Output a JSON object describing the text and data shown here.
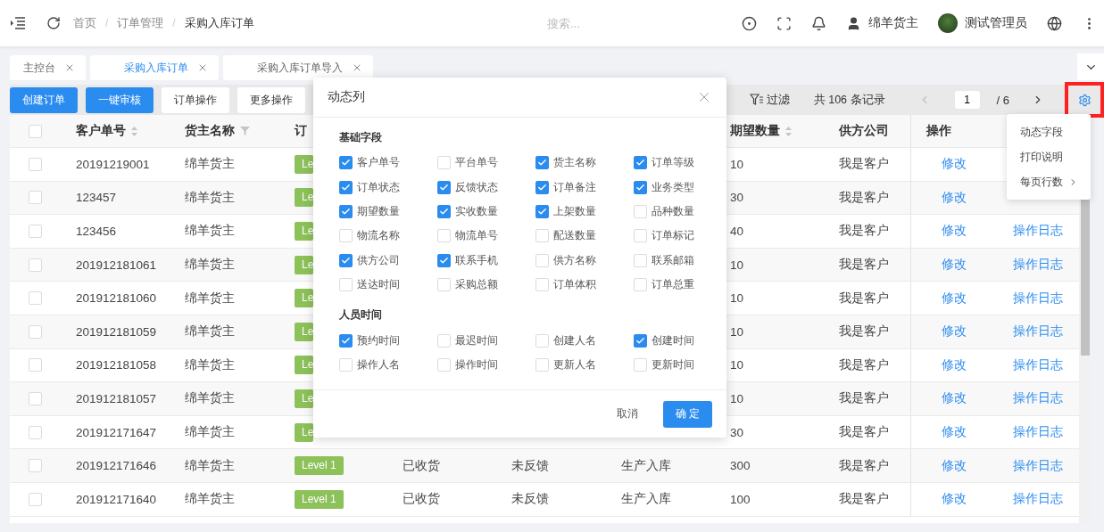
{
  "header": {
    "breadcrumb": [
      {
        "label": "首页",
        "current": false
      },
      {
        "label": "订单管理",
        "current": false
      },
      {
        "label": "采购入库订单",
        "current": true
      }
    ],
    "breadcrumb_separator": "/",
    "search": {
      "placeholder": "搜索..."
    },
    "user": "绵羊货主",
    "admin": "测试管理员"
  },
  "tabs": [
    {
      "label": "主控台",
      "selected": false
    },
    {
      "label": "采购入库订单",
      "selected": true
    },
    {
      "label": "采购入库订单导入",
      "selected": false
    }
  ],
  "toolbar": {
    "buttons": [
      {
        "label": "创建订单",
        "kind": "primary"
      },
      {
        "label": "一键审核",
        "kind": "primary"
      },
      {
        "label": "订单操作",
        "kind": "default"
      },
      {
        "label": "更多操作",
        "kind": "default"
      }
    ],
    "filter": "过滤",
    "total": "共 106 条记录",
    "page": "1",
    "pages": "/ 6",
    "settings_highlighted": true
  },
  "table": {
    "select_all_checked": false,
    "columns": [
      {
        "label": "客户单号",
        "kind": "sortable"
      },
      {
        "label": "货主名称",
        "kind": "filterable"
      },
      {
        "label": "订",
        "kind": "plain"
      },
      {
        "kind": "hidden"
      },
      {
        "kind": "hidden"
      },
      {
        "kind": "hidden"
      },
      {
        "label": "期望数量",
        "kind": "sortable"
      },
      {
        "label": "供方公司",
        "kind": "plain"
      },
      {
        "label": "操作",
        "kind": "plain"
      }
    ],
    "rows": [
      {
        "checked": false,
        "id": "20191219001",
        "owner": "绵羊货主",
        "level": "Le",
        "qty": "10",
        "supplier": "我是客户",
        "edit": "修改"
      },
      {
        "checked": false,
        "id": "123457",
        "owner": "绵羊货主",
        "level": "Le",
        "qty": "30",
        "supplier": "我是客户",
        "edit": "修改"
      },
      {
        "checked": false,
        "id": "123456",
        "owner": "绵羊货主",
        "level": "Le",
        "qty": "40",
        "supplier": "我是客户",
        "edit": "修改",
        "log": "操作日志"
      },
      {
        "checked": false,
        "id": "201912181061",
        "owner": "绵羊货主",
        "level": "Le",
        "qty": "10",
        "supplier": "我是客户",
        "edit": "修改",
        "log": "操作日志"
      },
      {
        "checked": false,
        "id": "201912181060",
        "owner": "绵羊货主",
        "level": "Le",
        "qty": "10",
        "supplier": "我是客户",
        "edit": "修改",
        "log": "操作日志"
      },
      {
        "checked": false,
        "id": "201912181059",
        "owner": "绵羊货主",
        "level": "Le",
        "qty": "10",
        "supplier": "我是客户",
        "edit": "修改",
        "log": "操作日志"
      },
      {
        "checked": false,
        "id": "201912181058",
        "owner": "绵羊货主",
        "level": "Le",
        "qty": "10",
        "supplier": "我是客户",
        "edit": "修改",
        "log": "操作日志"
      },
      {
        "checked": false,
        "id": "201912181057",
        "owner": "绵羊货主",
        "level": "Le",
        "qty": "10",
        "supplier": "我是客户",
        "edit": "修改",
        "log": "操作日志"
      },
      {
        "checked": false,
        "id": "201912171647",
        "owner": "绵羊货主",
        "level": "Le",
        "qty": "30",
        "supplier": "我是客户",
        "edit": "修改",
        "log": "操作日志"
      },
      {
        "checked": false,
        "id": "201912171646",
        "owner": "绵羊货主",
        "level": "Level 1",
        "status": "已收货",
        "feedback": "未反馈",
        "type": "生产入库",
        "qty": "300",
        "supplier": "我是客户",
        "edit": "修改",
        "log": "操作日志"
      },
      {
        "checked": false,
        "id": "201912171640",
        "owner": "绵羊货主",
        "level": "Level 1",
        "status": "已收货",
        "feedback": "未反馈",
        "type": "生产入库",
        "qty": "100",
        "supplier": "我是客户",
        "edit": "修改",
        "log": "操作日志"
      }
    ]
  },
  "menu": {
    "items": [
      {
        "label": "动态字段",
        "submenu": false
      },
      {
        "label": "打印说明",
        "submenu": false
      },
      {
        "label": "每页行数",
        "submenu": true
      }
    ]
  },
  "dialog": {
    "title": "动态列",
    "sections": [
      {
        "title": "基础字段",
        "options": [
          {
            "label": "客户单号",
            "checked": true
          },
          {
            "label": "平台单号",
            "checked": false
          },
          {
            "label": "货主名称",
            "checked": true
          },
          {
            "label": "订单等级",
            "checked": true
          },
          {
            "label": "订单状态",
            "checked": true
          },
          {
            "label": "反馈状态",
            "checked": true
          },
          {
            "label": "订单备注",
            "checked": true
          },
          {
            "label": "业务类型",
            "checked": true
          },
          {
            "label": "期望数量",
            "checked": true
          },
          {
            "label": "实收数量",
            "checked": true
          },
          {
            "label": "上架数量",
            "checked": true
          },
          {
            "label": "品种数量",
            "checked": false
          },
          {
            "label": "物流名称",
            "checked": false
          },
          {
            "label": "物流单号",
            "checked": false
          },
          {
            "label": "配送数量",
            "checked": false
          },
          {
            "label": "订单标记",
            "checked": false
          },
          {
            "label": "供方公司",
            "checked": true
          },
          {
            "label": "联系手机",
            "checked": true
          },
          {
            "label": "供方名称",
            "checked": false
          },
          {
            "label": "联系邮箱",
            "checked": false
          },
          {
            "label": "送达时间",
            "checked": false
          },
          {
            "label": "采购总额",
            "checked": false
          },
          {
            "label": "订单体积",
            "checked": false
          },
          {
            "label": "订单总重",
            "checked": false
          }
        ]
      },
      {
        "title": "人员时间",
        "options": [
          {
            "label": "预约时间",
            "checked": true
          },
          {
            "label": "最迟时间",
            "checked": false
          },
          {
            "label": "创建人名",
            "checked": false
          },
          {
            "label": "创建时间",
            "checked": true
          },
          {
            "label": "操作人名",
            "checked": false
          },
          {
            "label": "操作时间",
            "checked": false
          },
          {
            "label": "更新人名",
            "checked": false
          },
          {
            "label": "更新时间",
            "checked": false
          }
        ]
      }
    ],
    "cancel": "取消",
    "confirm": "确 定"
  }
}
